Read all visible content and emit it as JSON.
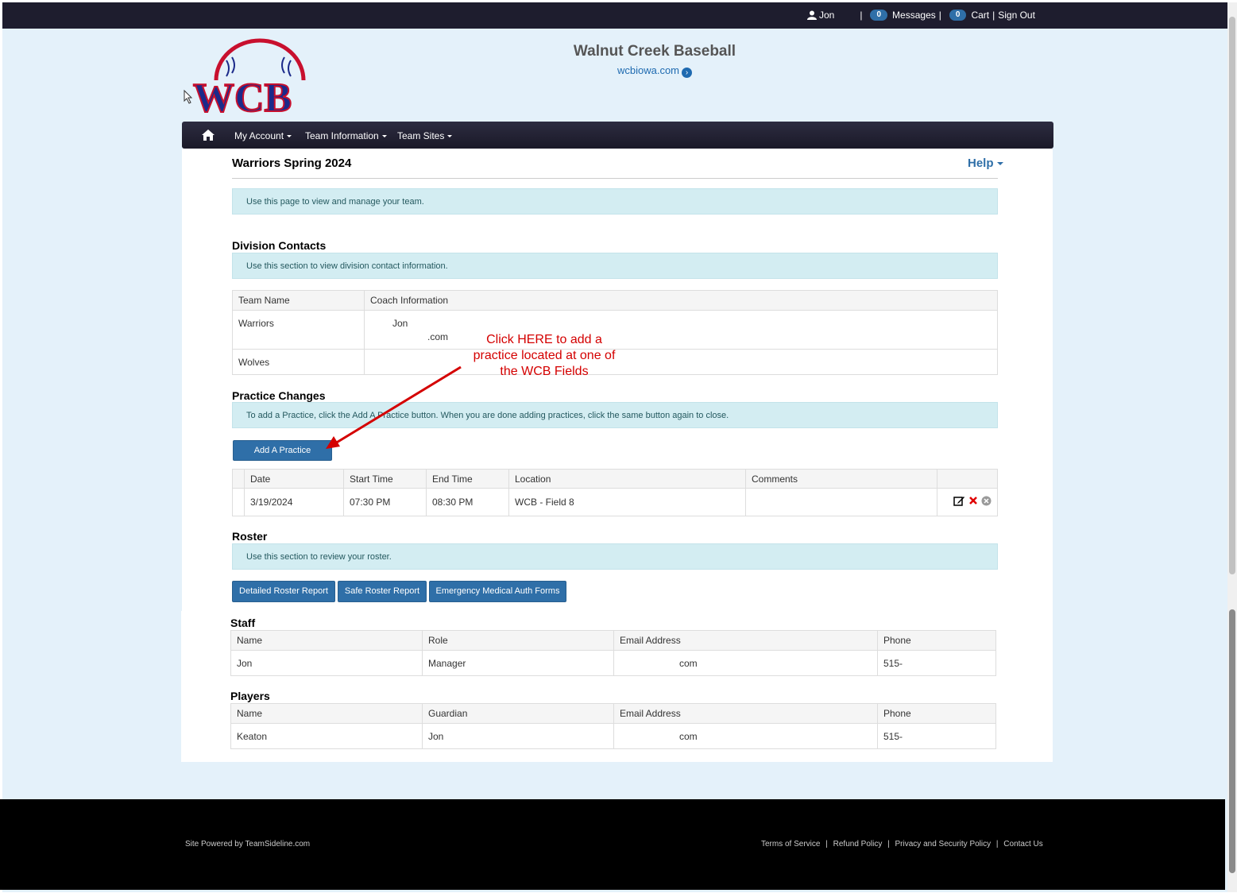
{
  "topbar": {
    "user": "Jon",
    "messages_count": "0",
    "messages_label": "Messages",
    "cart_count": "0",
    "cart_label": "Cart",
    "signout_label": "Sign Out"
  },
  "header": {
    "title": "Walnut Creek Baseball",
    "link": "wcbiowa.com",
    "logo_text": "WCB"
  },
  "nav": {
    "items": [
      {
        "label": "My Account"
      },
      {
        "label": "Team Information"
      },
      {
        "label": "Team Sites"
      }
    ]
  },
  "page": {
    "title": "Warriors Spring 2024",
    "help_label": "Help",
    "intro": "Use this page to view and manage your team."
  },
  "division_contacts": {
    "heading": "Division Contacts",
    "info": "Use this section to view division contact information.",
    "columns": [
      "Team Name",
      "Coach Information"
    ],
    "rows": [
      {
        "team": "Warriors",
        "coach_name": "Jon",
        "coach_email": ".com"
      },
      {
        "team": "Wolves",
        "coach_name": "",
        "coach_email": ""
      }
    ]
  },
  "annotation": {
    "line1": "Click HERE to add a",
    "line2": "practice located at one of",
    "line3": "the WCB Fields"
  },
  "practice_changes": {
    "heading": "Practice Changes",
    "info": "To add a Practice, click the Add A Practice button. When you are done adding practices, click the same button again to close.",
    "add_button": "Add A Practice",
    "columns": [
      "Date",
      "Start Time",
      "End Time",
      "Location",
      "Comments"
    ],
    "rows": [
      {
        "date": "3/19/2024",
        "start": "07:30 PM",
        "end": "08:30 PM",
        "location": "WCB - Field 8",
        "comments": ""
      }
    ]
  },
  "roster": {
    "heading": "Roster",
    "info": "Use this section to review your roster.",
    "buttons": [
      "Detailed Roster Report",
      "Safe Roster Report",
      "Emergency Medical Auth Forms"
    ]
  },
  "staff": {
    "heading": "Staff",
    "columns": [
      "Name",
      "Role",
      "Email Address",
      "Phone"
    ],
    "rows": [
      {
        "name": "Jon",
        "role": "Manager",
        "email": "com",
        "phone": "515-"
      }
    ]
  },
  "players": {
    "heading": "Players",
    "columns": [
      "Name",
      "Guardian",
      "Email Address",
      "Phone"
    ],
    "rows": [
      {
        "name": "Keaton",
        "guardian": "Jon",
        "email": "com",
        "phone": "515-"
      }
    ]
  },
  "footer": {
    "powered": "Site Powered by TeamSideline.com",
    "links": [
      "Terms of Service",
      "Refund Policy",
      "Privacy and Security Policy",
      "Contact Us"
    ]
  },
  "colors": {
    "accent": "#2f6fa8",
    "topbar": "#1e1d2e",
    "info_bg": "#d3edf2",
    "annotation": "#d40000"
  }
}
